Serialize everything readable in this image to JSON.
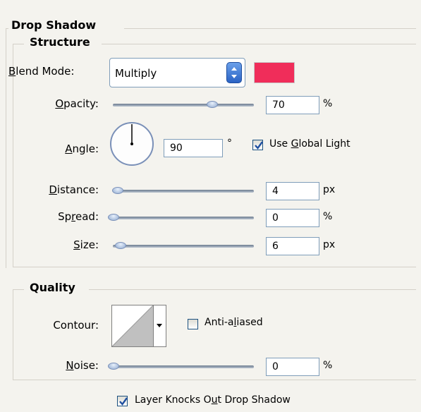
{
  "drop_shadow": {
    "title": "Drop Shadow",
    "structure": {
      "title": "Structure",
      "blend_mode": {
        "label_u": "B",
        "label_rest": "lend Mode:",
        "value": "Multiply",
        "color": "#f02d5a"
      },
      "opacity": {
        "label_u": "O",
        "label_rest": "pacity:",
        "value": "70",
        "unit": "%",
        "fraction": 0.7
      },
      "angle": {
        "label_u": "A",
        "label_rest": "ngle:",
        "value": "90",
        "unit": "°",
        "degrees": 90
      },
      "use_global_light": {
        "pre": "Use ",
        "u": "G",
        "post": "lobal Light",
        "checked": true
      },
      "distance": {
        "label_u": "D",
        "label_rest": "istance:",
        "value": "4",
        "unit": "px",
        "fraction": 0.03
      },
      "spread": {
        "label_pre": "Sp",
        "label_u": "r",
        "label_post": "ead:",
        "value": "0",
        "unit": "%",
        "fraction": 0.0
      },
      "size": {
        "label_u": "S",
        "label_rest": "ize:",
        "value": "6",
        "unit": "px",
        "fraction": 0.05
      }
    },
    "quality": {
      "title": "Quality",
      "contour_label": "Contour:",
      "anti_aliased": {
        "pre": "Anti-a",
        "u": "l",
        "post": "iased",
        "checked": false
      },
      "noise": {
        "label_u": "N",
        "label_rest": "oise:",
        "value": "0",
        "unit": "%",
        "fraction": 0.0
      }
    },
    "layer_knocks_out": {
      "pre": "Layer Knocks O",
      "u": "u",
      "post": "t Drop Shadow",
      "checked": true
    }
  }
}
